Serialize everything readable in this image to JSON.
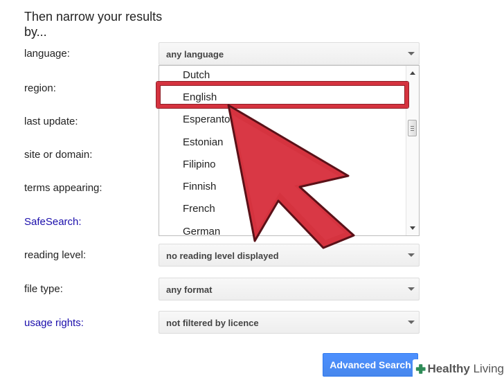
{
  "heading": "Then narrow your results by...",
  "labels": {
    "language": "language:",
    "region": "region:",
    "last_update": "last update:",
    "site_or_domain": "site or domain:",
    "terms_appearing": "terms appearing:",
    "safesearch": "SafeSearch:",
    "reading_level": "reading level:",
    "file_type": "file type:",
    "usage_rights": "usage rights:"
  },
  "selects": {
    "language": "any language",
    "reading_level": "no reading level displayed",
    "file_type": "any format",
    "usage_rights": "not filtered by licence"
  },
  "language_options": [
    "Dutch",
    "English",
    "Esperanto",
    "Estonian",
    "Filipino",
    "Finnish",
    "French",
    "German"
  ],
  "highlighted_option": "English",
  "button": {
    "label": "Advanced Search"
  },
  "watermark": {
    "brand_bold": "Healthy",
    "brand_light": " Living"
  },
  "colors": {
    "accent_red": "#d5333f",
    "link_blue": "#1a0dab",
    "button_blue": "#4d90fe",
    "watermark_green": "#2e8b57"
  }
}
